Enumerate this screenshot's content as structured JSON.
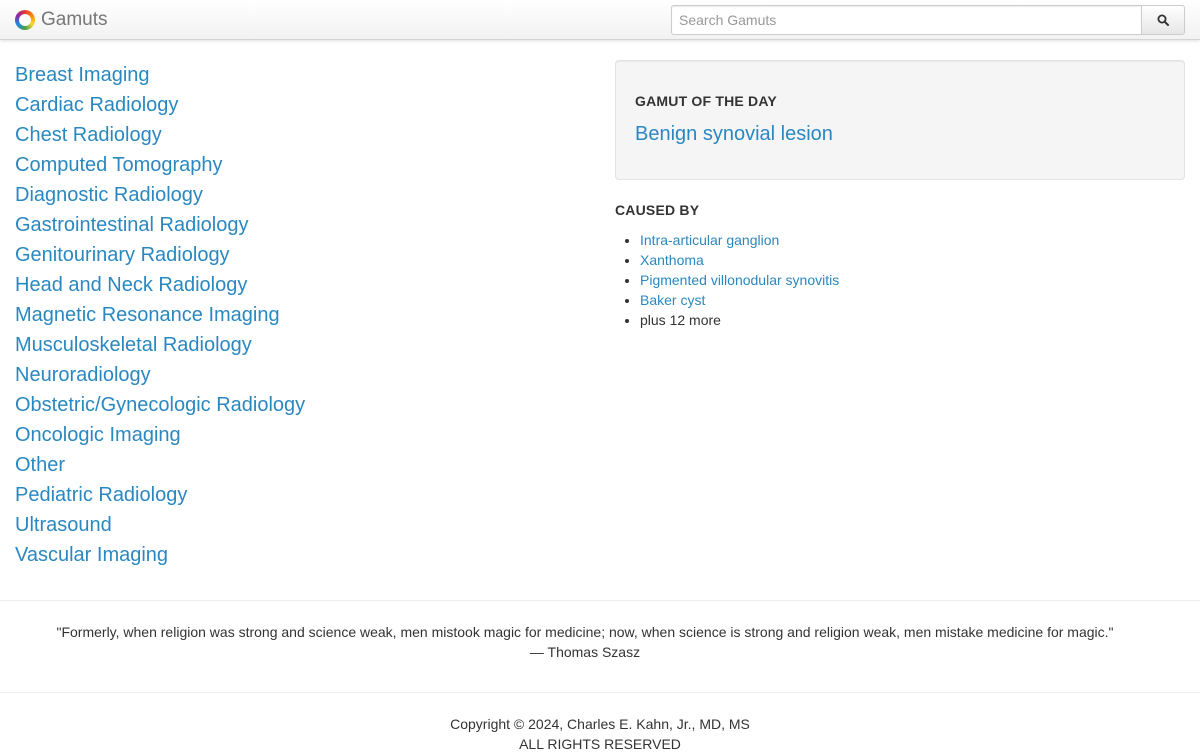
{
  "navbar": {
    "brand": "Gamuts",
    "search_placeholder": "Search Gamuts",
    "search_icon": "search-icon"
  },
  "specialties": [
    "Breast Imaging",
    "Cardiac Radiology",
    "Chest Radiology",
    "Computed Tomography",
    "Diagnostic Radiology",
    "Gastrointestinal Radiology",
    "Genitourinary Radiology",
    "Head and Neck Radiology",
    "Magnetic Resonance Imaging",
    "Musculoskeletal Radiology",
    "Neuroradiology",
    "Obstetric/Gynecologic Radiology",
    "Oncologic Imaging",
    "Other",
    "Pediatric Radiology",
    "Ultrasound",
    "Vascular Imaging"
  ],
  "gamut_of_the_day": {
    "heading": "GAMUT OF THE DAY",
    "title": "Benign synovial lesion"
  },
  "caused_by": {
    "heading": "CAUSED BY",
    "items": [
      "Intra-articular ganglion",
      "Xanthoma",
      "Pigmented villonodular synovitis",
      "Baker cyst"
    ],
    "more": "plus 12 more"
  },
  "quote": {
    "text": "\"Formerly, when religion was strong and science weak, men mistook magic for medicine; now, when science is strong and religion weak, men mistake medicine for magic.\"",
    "author": "— Thomas Szasz"
  },
  "footer": {
    "copyright": "Copyright © 2024, Charles E. Kahn, Jr., MD, MS",
    "rights": "ALL RIGHTS RESERVED"
  },
  "colors": {
    "link": "#2a88c0",
    "text": "#333333",
    "panel_bg": "#f5f5f5"
  }
}
